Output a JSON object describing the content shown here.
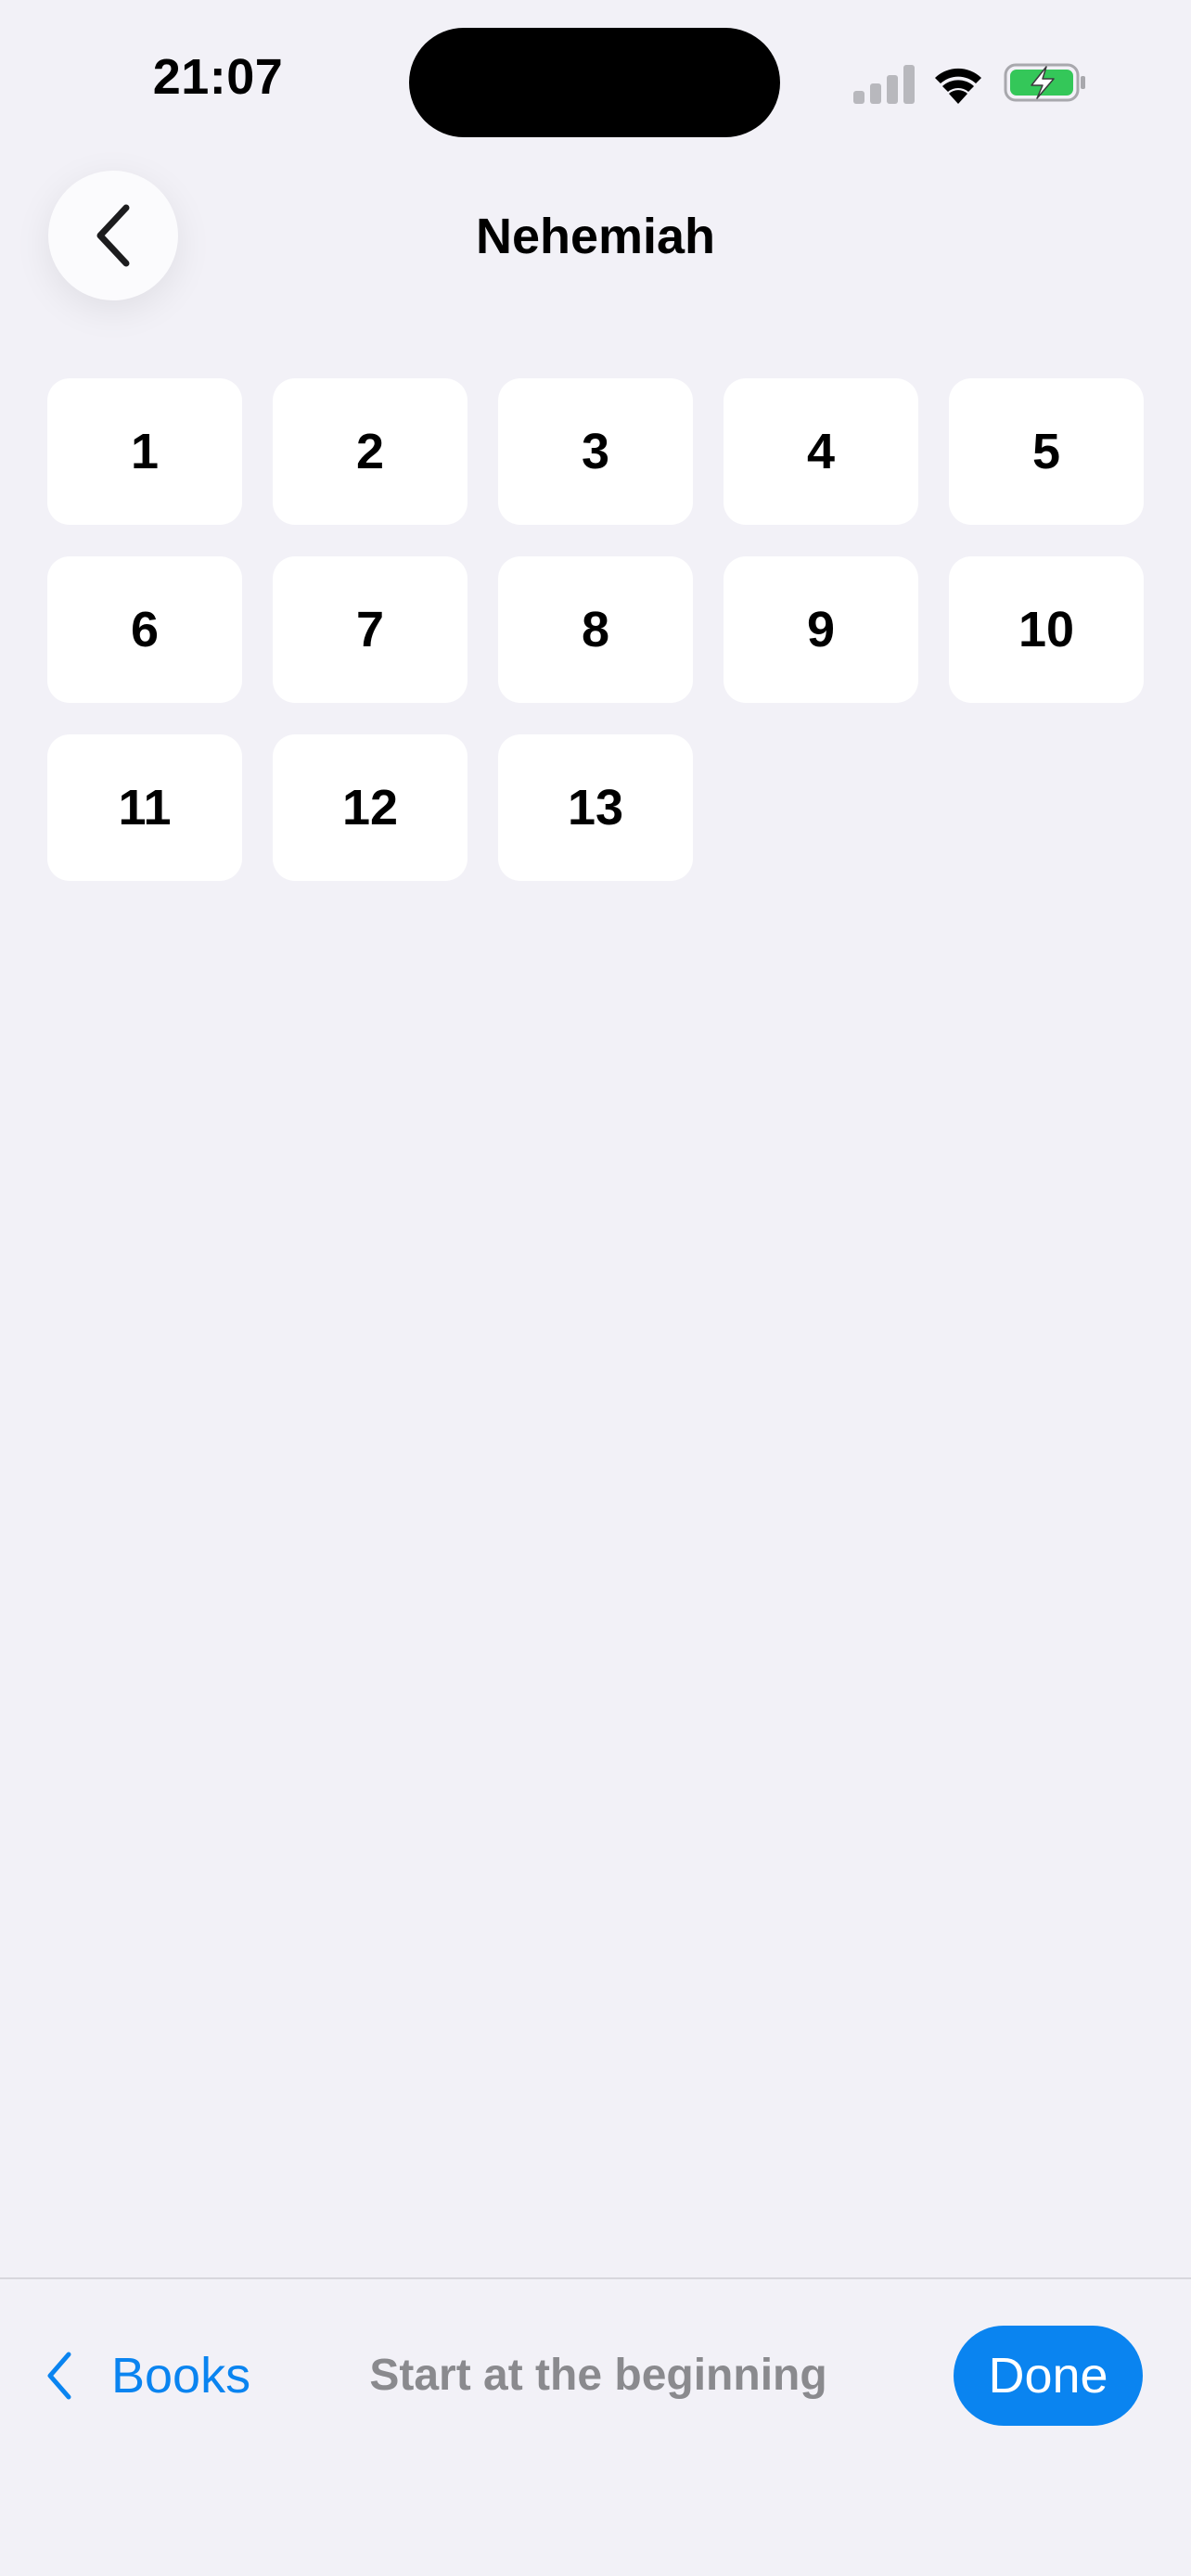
{
  "status_bar": {
    "time": "21:07"
  },
  "header": {
    "title": "Nehemiah"
  },
  "chapters": [
    "1",
    "2",
    "3",
    "4",
    "5",
    "6",
    "7",
    "8",
    "9",
    "10",
    "11",
    "12",
    "13"
  ],
  "bottom_bar": {
    "books_label": "Books",
    "start_label": "Start at the beginning",
    "done_label": "Done"
  },
  "colors": {
    "background": "#f2f1f7",
    "accent": "#0a84f0",
    "battery": "#34c759",
    "muted_text": "#8a8a8e"
  },
  "icons": {
    "back": "chevron-left-icon",
    "books_back": "chevron-left-icon",
    "signal": "cellular-signal-icon",
    "wifi": "wifi-icon",
    "battery": "battery-charging-icon"
  }
}
